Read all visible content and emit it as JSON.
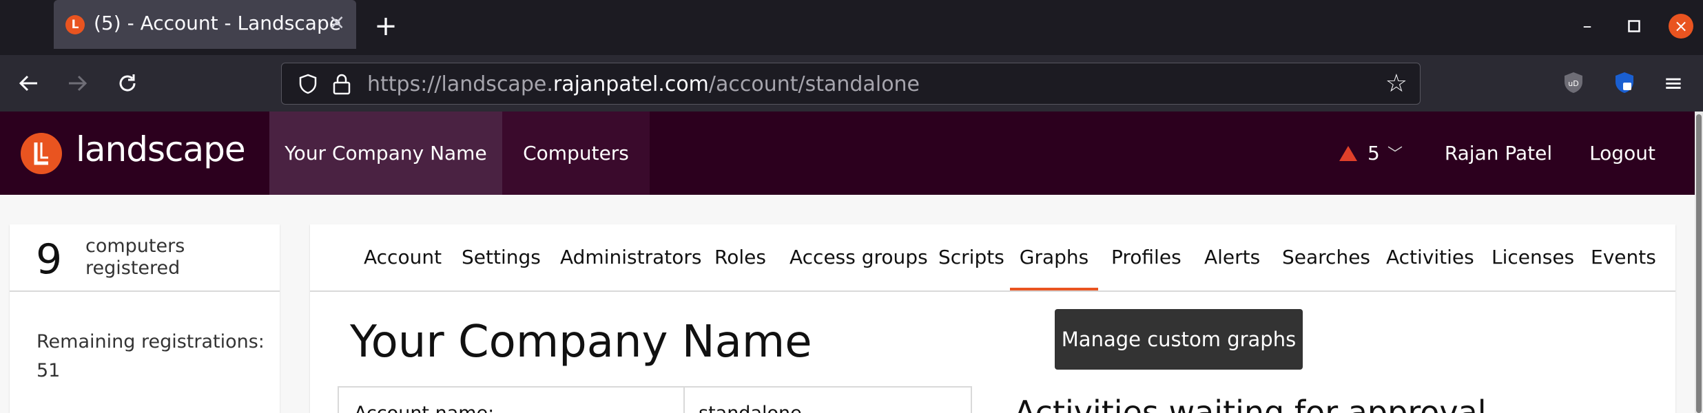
{
  "browser": {
    "tab_title": "(5) - Account - Landscape",
    "url_prefix": "https://landscape.",
    "url_host": "rajanpatel.com",
    "url_path": "/account/standalone"
  },
  "header": {
    "logo_text": "landscape",
    "company_name": "Your Company Name",
    "computers_label": "Computers",
    "alert_count": "5",
    "user_name": "Rajan Patel",
    "logout_label": "Logout"
  },
  "sidebar": {
    "computer_count": "9",
    "computers_label": "computers registered",
    "remaining_label": "Remaining registrations:",
    "remaining_value": "51"
  },
  "subnav": {
    "items": [
      "Account",
      "Settings",
      "Administrators",
      "Roles",
      "Access groups",
      "Scripts",
      "Graphs",
      "Profiles",
      "Alerts",
      "Searches",
      "Activities",
      "Licenses",
      "Events"
    ],
    "active": "Graphs"
  },
  "main": {
    "title": "Your Company Name",
    "manage_button": "Manage custom graphs",
    "table_label": "Account name:",
    "table_value": "standalone",
    "activities_title": "Activities waiting for approval"
  },
  "colors": {
    "accent": "#e95420",
    "header_bg": "#2c001e"
  }
}
